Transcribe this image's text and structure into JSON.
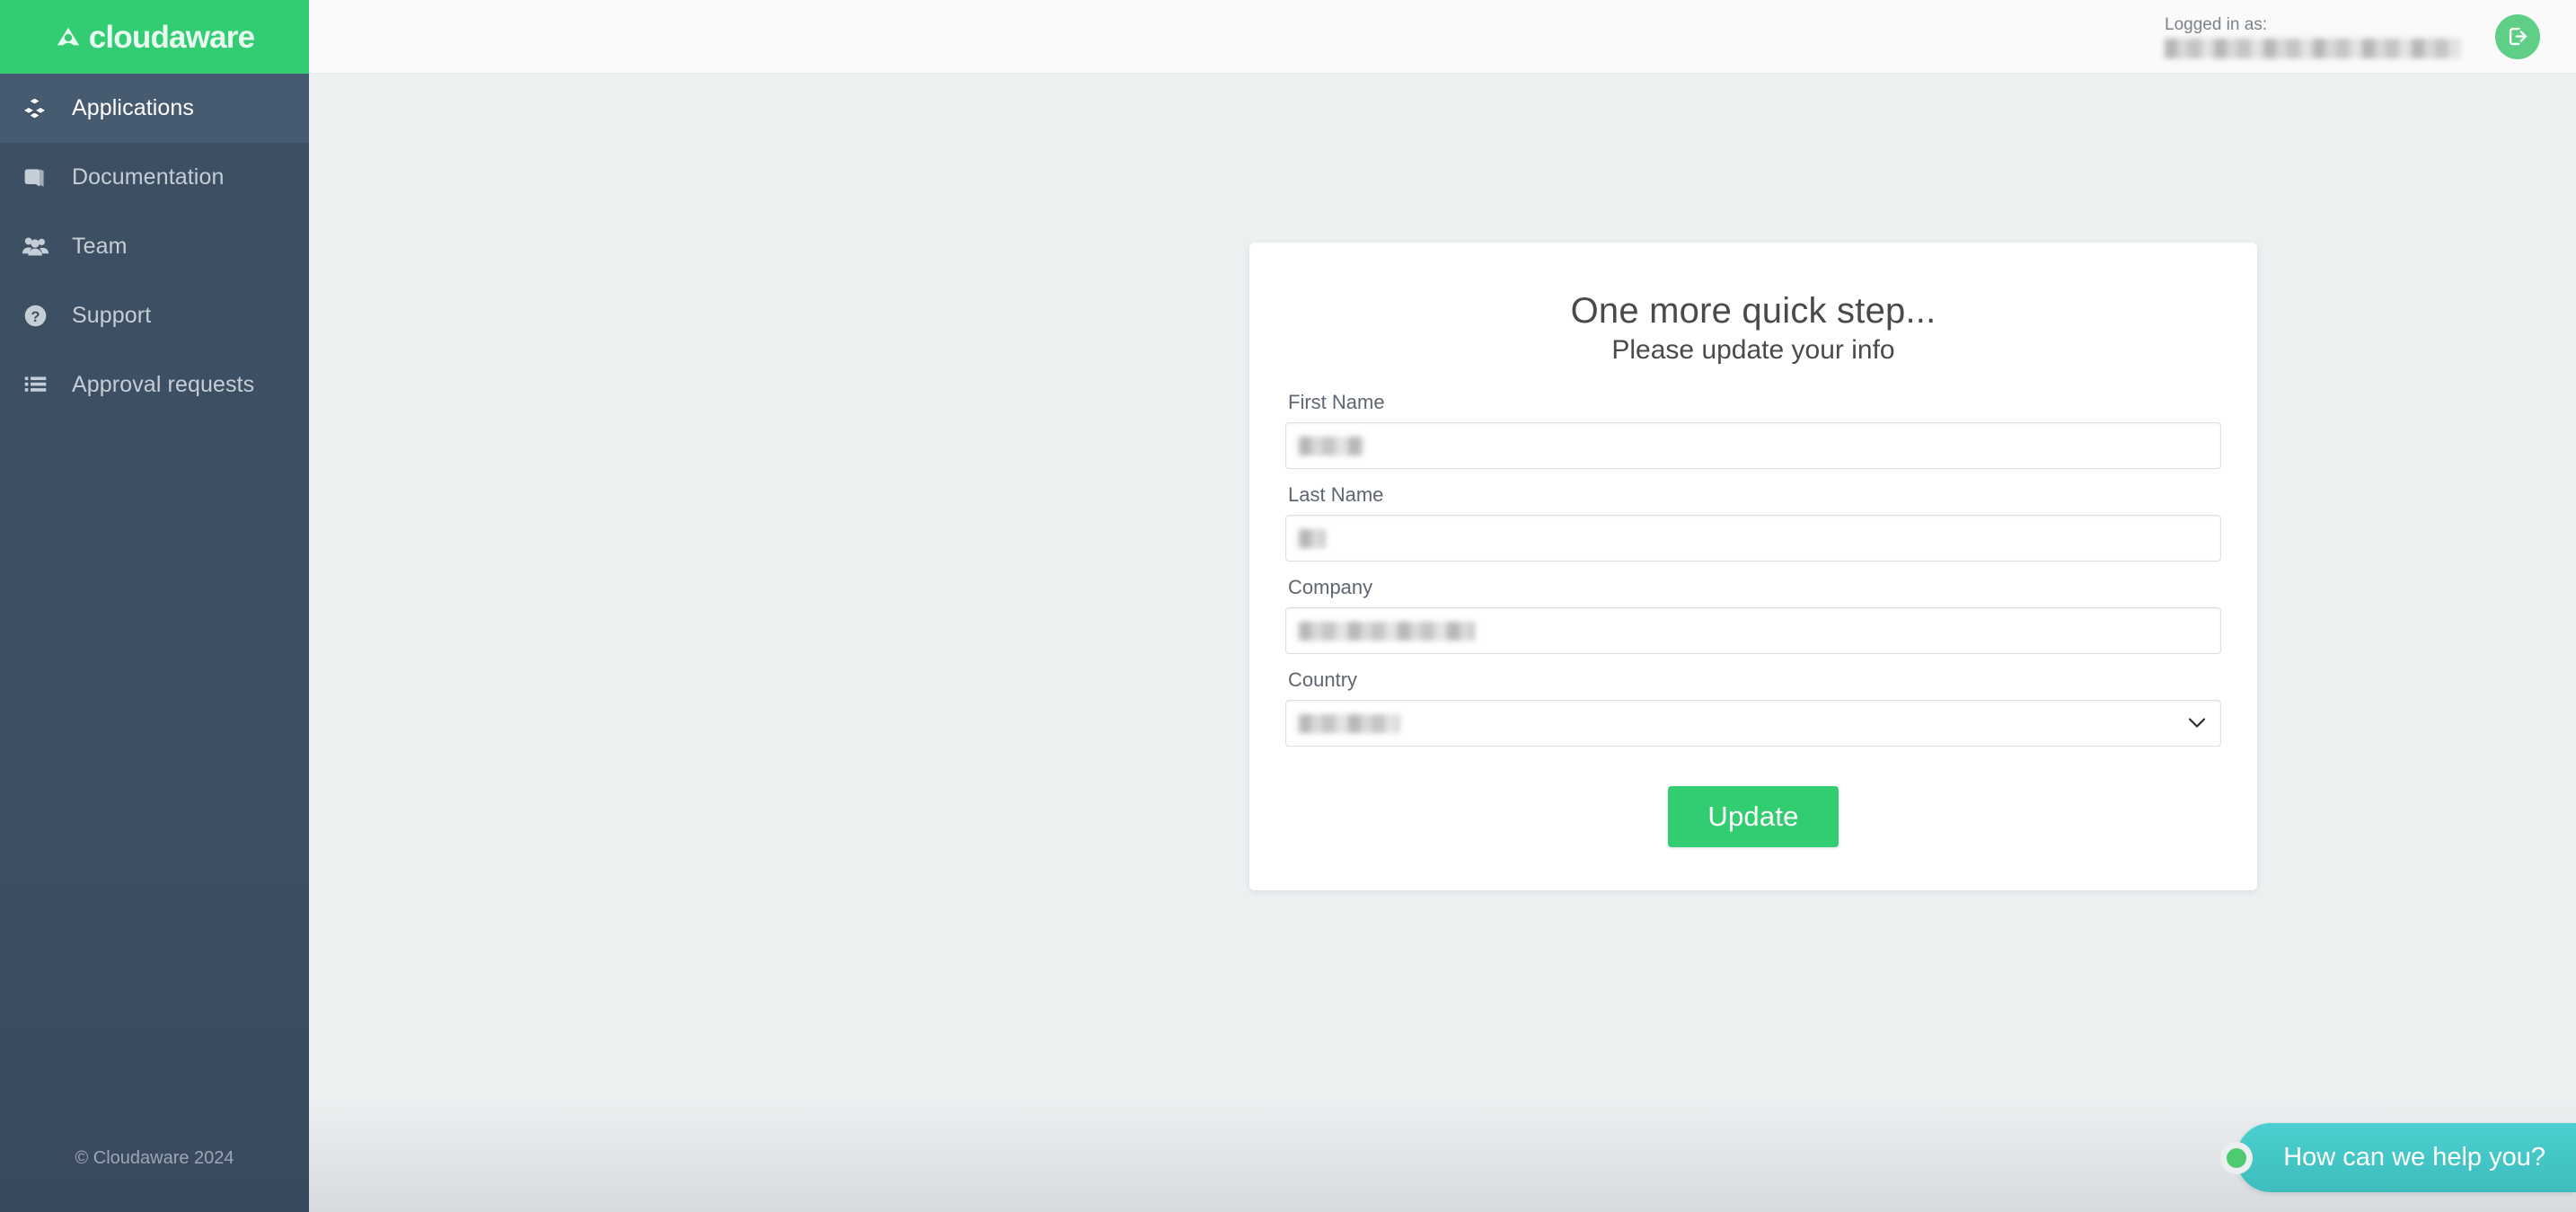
{
  "brand": {
    "logo_text": "cloudaware",
    "logo_icon": "cloudaware-mark-icon",
    "accent_green": "#32cc72",
    "sidebar_bg": "#3d4f63",
    "content_bg": "#ecf0f1"
  },
  "sidebar": {
    "items": [
      {
        "label": "Applications",
        "icon": "cubes-icon",
        "active": true
      },
      {
        "label": "Documentation",
        "icon": "book-icon",
        "active": false
      },
      {
        "label": "Team",
        "icon": "users-icon",
        "active": false
      },
      {
        "label": "Support",
        "icon": "question-circle-icon",
        "active": false
      },
      {
        "label": "Approval requests",
        "icon": "list-icon",
        "active": false
      }
    ],
    "footer": "© Cloudaware 2024"
  },
  "topbar": {
    "logged_in_label": "Logged in as:",
    "logged_in_user": "",
    "logout_icon": "logout-icon"
  },
  "card": {
    "title": "One more quick step...",
    "subtitle": "Please update your info",
    "fields": [
      {
        "label": "First Name",
        "value": "",
        "type": "text"
      },
      {
        "label": "Last Name",
        "value": "",
        "type": "text"
      },
      {
        "label": "Company",
        "value": "",
        "type": "text"
      },
      {
        "label": "Country",
        "value": "",
        "type": "select"
      }
    ],
    "submit_label": "Update"
  },
  "chat": {
    "message": "How can we help you?",
    "status_color": "#4ecb71",
    "bubble_color": "#42c6c7"
  }
}
